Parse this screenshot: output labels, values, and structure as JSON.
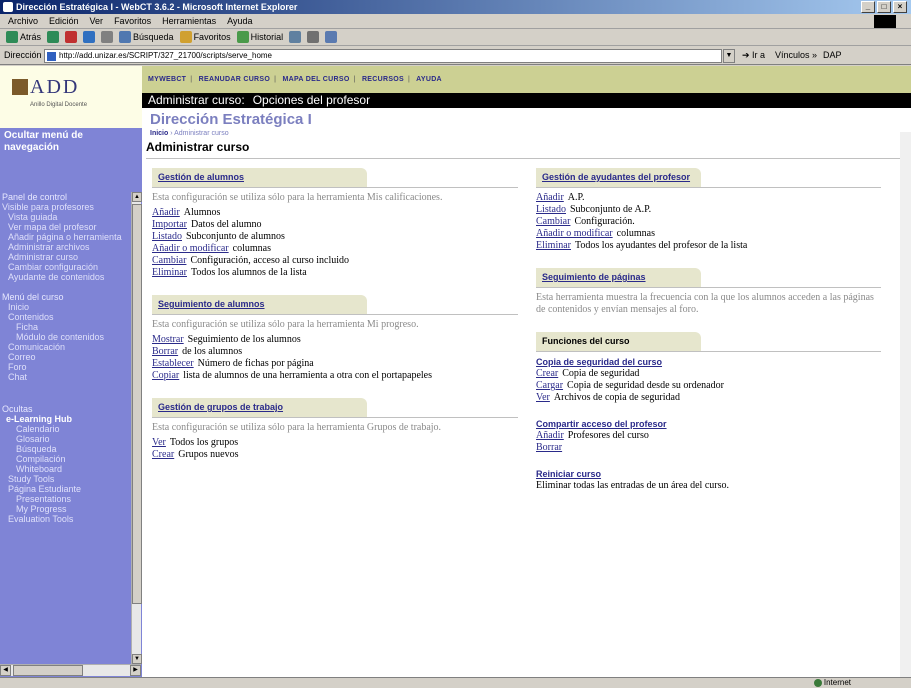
{
  "window": {
    "title": "Dirección Estratégica I - WebCT 3.6.2 - Microsoft Internet Explorer",
    "buttons": [
      "_",
      "□",
      "×"
    ]
  },
  "menubar": [
    "Archivo",
    "Edición",
    "Ver",
    "Favoritos",
    "Herramientas",
    "Ayuda"
  ],
  "toolbar": {
    "back": "Atrás",
    "search": "Búsqueda",
    "favorites": "Favoritos",
    "history": "Historial"
  },
  "address": {
    "label": "Dirección",
    "url": "http://add.unizar.es/SCRIPT/327_21700/scripts/serve_home",
    "go": "Ir a",
    "links": [
      "Vínculos »",
      "DAP"
    ]
  },
  "sidebar": {
    "logo": "ADD",
    "logo_sub": "Anillo Digital Docente",
    "hide_menu": "Ocultar menú de navegación",
    "sections": [
      {
        "title": "Panel de control",
        "items": [
          "Visible para profesores",
          "Vista guiada",
          "Ver mapa del profesor",
          "Añadir página o herramienta",
          "Administrar archivos",
          "Administrar curso",
          "Cambiar configuración",
          "Ayudante de contenidos"
        ]
      },
      {
        "title": "Menú del curso",
        "items": [
          "Inicio",
          "Contenidos",
          "Ficha",
          "Módulo de contenidos",
          "Comunicación",
          "Correo",
          "Foro",
          "Chat"
        ]
      },
      {
        "title": "Ocultas",
        "items": [
          "e-Learning Hub",
          "Calendario",
          "Glosario",
          "Búsqueda",
          "Compilación",
          "Whiteboard",
          "Study Tools",
          "Página Estudiante",
          "Presentations",
          "My Progress",
          "Evaluation Tools"
        ]
      }
    ]
  },
  "topnav": [
    "MYWEBCT",
    "REANUDAR CURSO",
    "MAPA DEL CURSO",
    "RECURSOS",
    "AYUDA"
  ],
  "header": {
    "bar_left": "Administrar curso:",
    "bar_right": "Opciones del profesor",
    "course_title": "Dirección Estratégica I",
    "breadcrumb_home": "Inicio",
    "breadcrumb_current": "Administrar curso"
  },
  "page": {
    "heading": "Administrar curso",
    "left": [
      {
        "title": "Gestión de alumnos",
        "desc": "Esta configuración se utiliza sólo para la herramienta Mis calificaciones.",
        "rows": [
          {
            "link": "Añadir",
            "text": "Alumnos"
          },
          {
            "link": "Importar",
            "text": "Datos del alumno"
          },
          {
            "link": "Listado",
            "text": "Subconjunto de alumnos"
          },
          {
            "link": "Añadir o modificar",
            "text": "columnas"
          },
          {
            "link": "Cambiar",
            "text": "Configuración, acceso al curso incluido"
          },
          {
            "link": "Eliminar",
            "text": "Todos los alumnos de la lista"
          }
        ]
      },
      {
        "title": "Seguimiento de alumnos",
        "desc": "Esta configuración se utiliza sólo para la herramienta Mi progreso.",
        "rows": [
          {
            "link": "Mostrar",
            "text": "Seguimiento de los alumnos"
          },
          {
            "link": "Borrar",
            "text": "de los alumnos"
          },
          {
            "link": "Establecer",
            "text": "Número de fichas por página"
          },
          {
            "link": "Copiar",
            "text": "lista de alumnos de una herramienta a otra con el portapapeles"
          }
        ]
      },
      {
        "title": "Gestión de grupos de trabajo",
        "desc": "Esta configuración se utiliza sólo para la herramienta Grupos de trabajo.",
        "rows": [
          {
            "link": "Ver",
            "text": "Todos los grupos"
          },
          {
            "link": "Crear",
            "text": "Grupos nuevos"
          }
        ]
      }
    ],
    "right": {
      "assistants": {
        "title": "Gestión de ayudantes del profesor",
        "rows": [
          {
            "link": "Añadir",
            "text": "A.P."
          },
          {
            "link": "Listado",
            "text": "Subconjunto de A.P."
          },
          {
            "link": "Cambiar",
            "text": "Configuración."
          },
          {
            "link": "Añadir o modificar",
            "text": "columnas"
          },
          {
            "link": "Eliminar",
            "text": "Todos los ayudantes del profesor de la lista"
          }
        ]
      },
      "tracking": {
        "title": "Seguimiento de páginas",
        "desc": "Esta herramienta muestra la frecuencia con la que los alumnos acceden a las páginas de contenidos y envían mensajes al foro."
      },
      "functions": {
        "title": "Funciones del curso",
        "backup_title": "Copia de seguridad del curso",
        "backup_rows": [
          {
            "link": "Crear",
            "text": "Copia de seguridad"
          },
          {
            "link": "Cargar",
            "text": "Copia de seguridad desde su ordenador"
          },
          {
            "link": "Ver",
            "text": "Archivos de copia de seguridad"
          }
        ],
        "share_title": "Compartir acceso del profesor",
        "share_rows": [
          {
            "link": "Añadir",
            "text": "Profesores del curso"
          },
          {
            "link": "Borrar",
            "text": ""
          }
        ],
        "restart_title": "Reiniciar curso",
        "restart_desc": "Eliminar todas las entradas de un área del curso."
      }
    }
  },
  "status": {
    "left": "",
    "zone": "Internet"
  }
}
